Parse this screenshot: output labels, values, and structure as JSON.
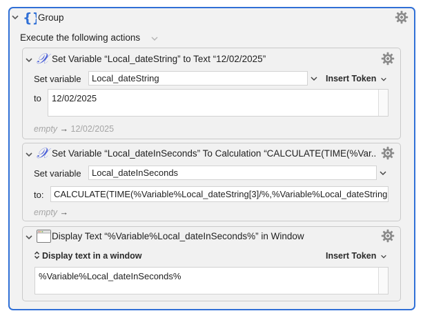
{
  "group": {
    "title": "Group",
    "execute_label": "Execute the following actions"
  },
  "actions": [
    {
      "title": "Set Variable “Local_dateString” to Text “12/02/2025”",
      "set_label": "Set variable",
      "variable": "Local_dateString",
      "insert_token": "Insert Token",
      "to_label": "to",
      "text_value": "12/02/2025",
      "result_empty": "empty",
      "result_arrow": "→",
      "result_value": "12/02/2025"
    },
    {
      "title": "Set Variable “Local_dateInSeconds” To Calculation “CALCULATE(TIME(%Var...",
      "set_label": "Set variable",
      "variable": "Local_dateInSeconds",
      "to_label": "to:",
      "calc_value": "CALCULATE(TIME(%Variable%Local_dateString[3]/%,%Variable%Local_dateString",
      "result_empty": "empty",
      "result_arrow": "→"
    },
    {
      "title": "Display Text “%Variable%Local_dateInSeconds%” in Window",
      "mode_label": "Display text in a window",
      "insert_token": "Insert Token",
      "text_value": "%Variable%Local_dateInSeconds%"
    }
  ],
  "colors": {
    "group_border": "#2f6fd6",
    "group_icon": "#2f6fd6",
    "variable_icon": "#4a5fd8"
  }
}
